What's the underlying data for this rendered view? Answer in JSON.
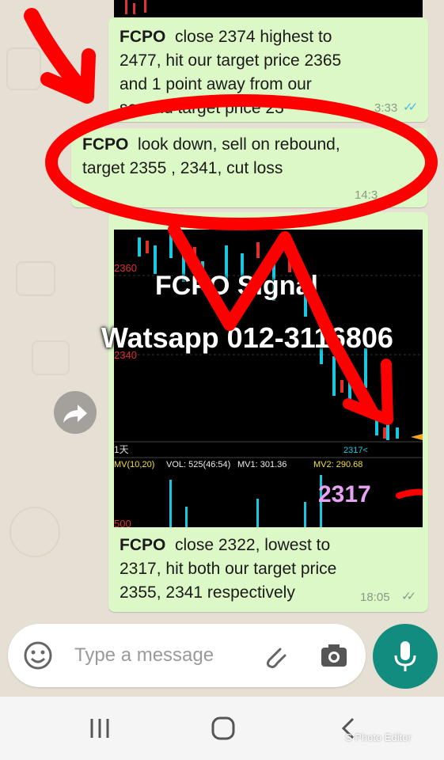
{
  "messages": [
    {
      "sender": "FCPO",
      "line1": "close 2374 highest to",
      "line2": "2477, hit our target price 2365",
      "line3": "and 1 point away from our",
      "line4": "second target price 23",
      "time": "3:33"
    },
    {
      "sender": "FCPO",
      "line1": "look down, sell on rebound,",
      "line2": "target  2355  , 2341, cut loss",
      "time": "14:3"
    },
    {
      "sender": "FCPO",
      "line1": "close 2322, lowest to",
      "line2": "2317, hit both our target price",
      "line3": "2355, 2341 respectively",
      "time": "18:05"
    }
  ],
  "chart": {
    "price_labels": [
      "2360",
      "2340"
    ],
    "low_label": "2317<",
    "period_label": "1天",
    "indicator": "MV(10,20)",
    "vol": "VOL: 525(46:54)",
    "mv1": "MV1: 301.36",
    "mv2": "MV2: 290.68",
    "vol_axis": "500",
    "big_price": "2317"
  },
  "overlay": {
    "title": "FCPO Signal",
    "contact": "Watsapp  012-3116806"
  },
  "input": {
    "placeholder": "Type a message"
  },
  "watermark": "S Photo Editor",
  "icons": [
    "share-icon",
    "emoji-icon",
    "attach-icon",
    "camera-icon",
    "mic-icon",
    "recents-icon",
    "home-icon",
    "back-icon"
  ],
  "colors": {
    "bubble": "#dcf8c6",
    "accent": "#128c7e",
    "annotation": "#ff0000",
    "read_ticks": "#4fb5ea"
  }
}
